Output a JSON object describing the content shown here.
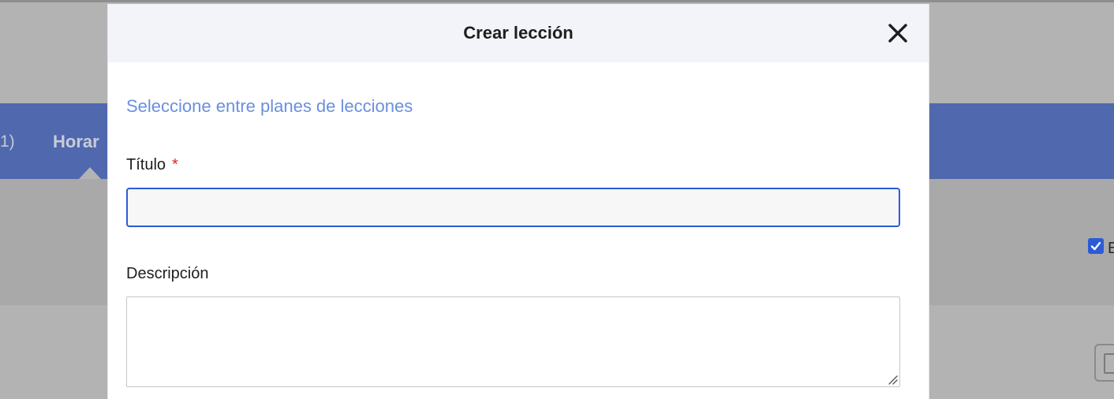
{
  "background": {
    "nav": {
      "count_fragment": "1)",
      "active_tab_fragment": "Horar"
    },
    "filter": {
      "checkbox_checked": true,
      "checkbox_label_fragment": "E"
    },
    "colors": {
      "overlay": "#b3b3b3",
      "nav_band": "#5068ad",
      "checkbox": "#2c5bd6"
    }
  },
  "modal": {
    "title": "Crear lección",
    "close_icon": "close-icon",
    "lesson_plans_link": "Seleccione entre planes de lecciones",
    "form": {
      "title_label": "Título",
      "title_required_mark": "*",
      "title_value": "",
      "description_label": "Descripción",
      "description_value": ""
    },
    "colors": {
      "header_bg": "#f3f4f9",
      "link": "#6a8fe0",
      "focus_border": "#2c5bd6",
      "required": "#d9262b"
    }
  }
}
